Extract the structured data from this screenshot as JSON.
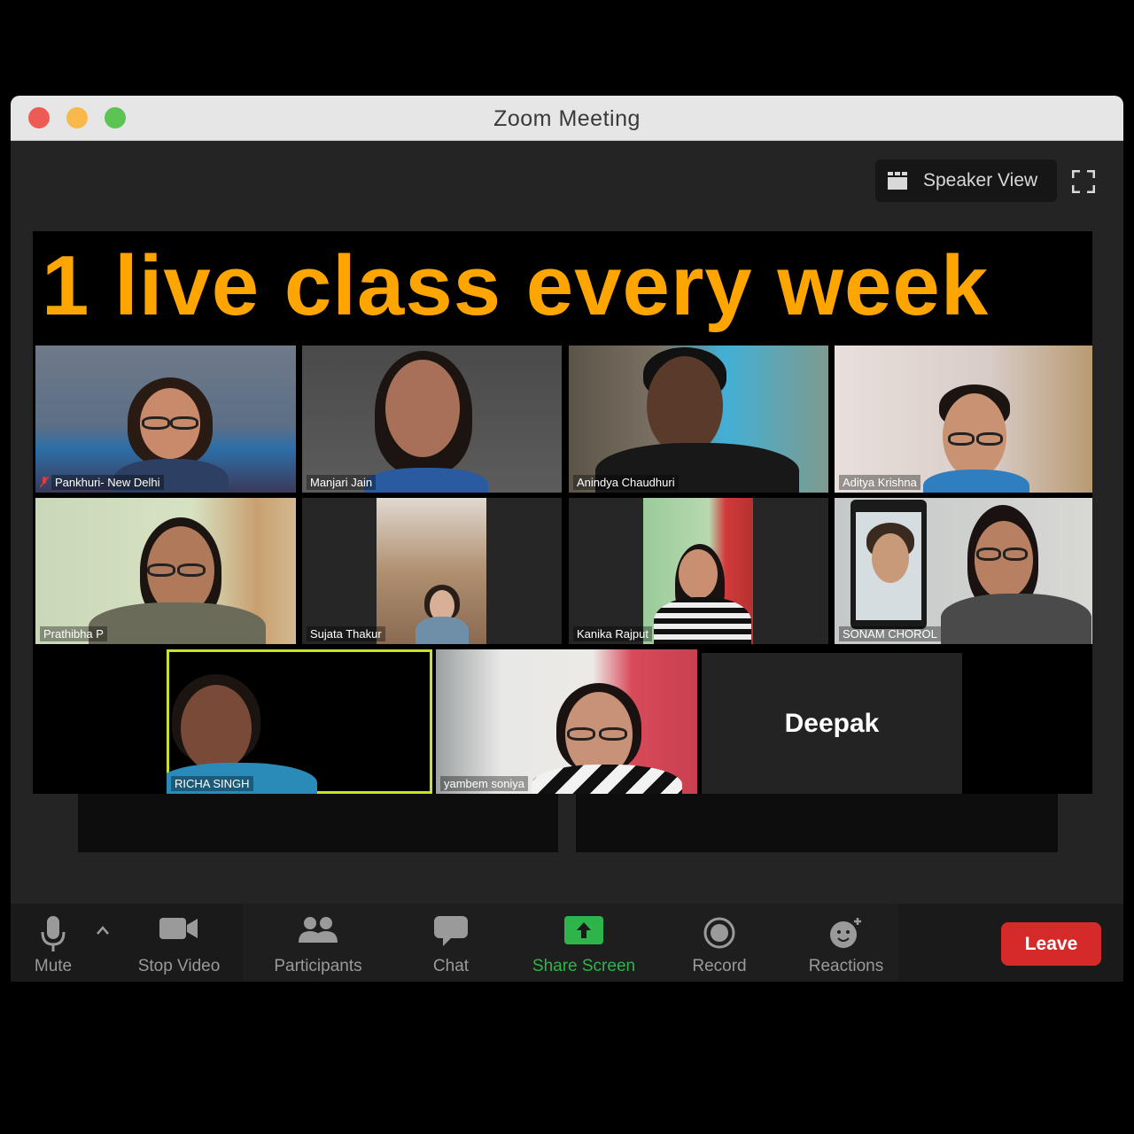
{
  "window": {
    "title": "Zoom Meeting"
  },
  "view": {
    "label": "Speaker View",
    "icon": "gallery-grid-icon"
  },
  "banner": {
    "text": "1 live class every week",
    "color": "#ffa500"
  },
  "participants": [
    {
      "name": "Pankhuri- New Delhi",
      "muted": true
    },
    {
      "name": "Manjari Jain"
    },
    {
      "name": "Anindya Chaudhuri"
    },
    {
      "name": "Aditya Krishna"
    },
    {
      "name": "Prathibha P"
    },
    {
      "name": "Sujata Thakur"
    },
    {
      "name": "Kanika Rajput"
    },
    {
      "name": "SONAM CHOROL"
    },
    {
      "name": "RICHA SINGH",
      "active_speaker": true
    },
    {
      "name": "yambem soniya"
    },
    {
      "name": "Deepak",
      "video_off": true
    }
  ],
  "toolbar": {
    "mute": "Mute",
    "stop_video": "Stop Video",
    "participants": "Participants",
    "chat": "Chat",
    "share_screen": "Share Screen",
    "record": "Record",
    "reactions": "Reactions",
    "leave": "Leave"
  },
  "colors": {
    "share_green": "#2fb34b",
    "leave_red": "#d42a2a",
    "active_border": "#c9e12c"
  }
}
